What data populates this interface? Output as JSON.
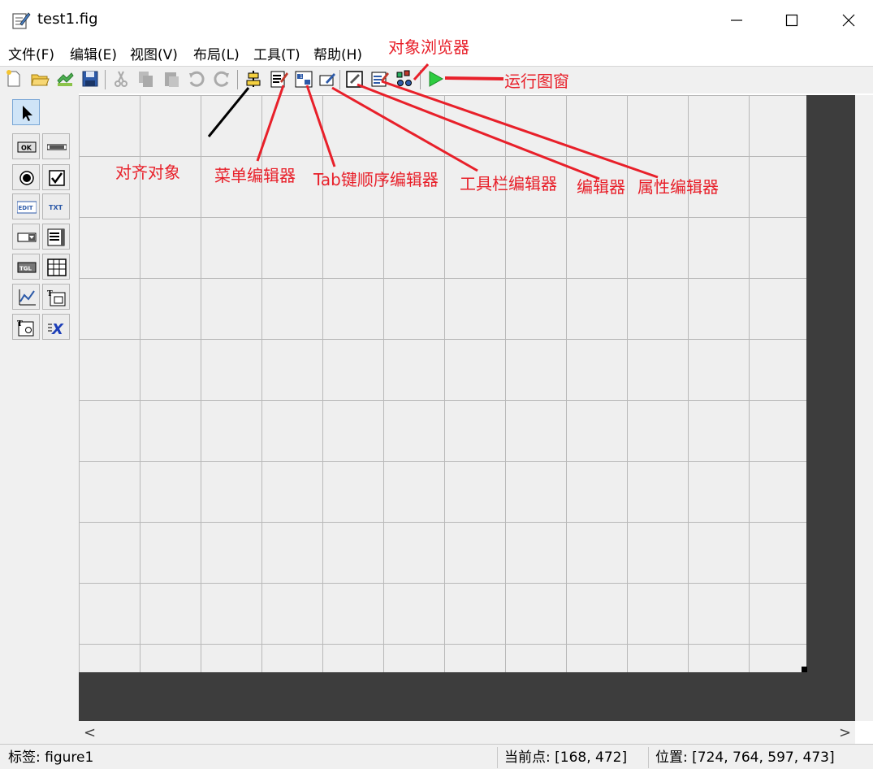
{
  "window": {
    "title": "test1.fig",
    "icon": "figure-file-icon",
    "controls": {
      "minimize": "minimize-icon",
      "maximize": "maximize-icon",
      "close": "close-icon"
    }
  },
  "menubar": {
    "items": [
      "文件(F)",
      "编辑(E)",
      "视图(V)",
      "布局(L)",
      "工具(T)",
      "帮助(H)"
    ]
  },
  "toolbar": {
    "icons": [
      "new-file-icon",
      "open-folder-icon",
      "save-as-icon",
      "save-icon",
      "cut-icon",
      "copy-icon",
      "paste-icon",
      "undo-icon",
      "redo-icon",
      "align-objects-icon",
      "menu-editor-icon",
      "tab-order-editor-icon",
      "toolbar-editor-icon",
      "editor-icon",
      "property-inspector-icon",
      "object-browser-icon",
      "run-figure-icon"
    ]
  },
  "palette": {
    "items": [
      {
        "name": "select-arrow-icon",
        "text": ""
      },
      {
        "name": "push-button-icon",
        "text": "OK"
      },
      {
        "name": "slider-icon",
        "text": ""
      },
      {
        "name": "radio-button-icon",
        "text": ""
      },
      {
        "name": "checkbox-icon",
        "text": ""
      },
      {
        "name": "edit-text-icon",
        "text": "EDIT"
      },
      {
        "name": "static-text-icon",
        "text": "TXT"
      },
      {
        "name": "popup-menu-icon",
        "text": ""
      },
      {
        "name": "listbox-icon",
        "text": ""
      },
      {
        "name": "toggle-button-icon",
        "text": "TGL"
      },
      {
        "name": "table-icon",
        "text": ""
      },
      {
        "name": "axes-icon",
        "text": ""
      },
      {
        "name": "panel-icon",
        "text": "T"
      },
      {
        "name": "button-group-icon",
        "text": "T"
      },
      {
        "name": "activex-icon",
        "text": "X"
      }
    ]
  },
  "annotations": {
    "object_browser": "对象浏览器",
    "run_figure": "运行图窗",
    "align_objects": "对齐对象",
    "menu_editor": "菜单编辑器",
    "tab_order_editor": "Tab键顺序编辑器",
    "toolbar_editor": "工具栏编辑器",
    "editor": "编辑器",
    "property_inspector": "属性编辑器",
    "color": "#e8202a"
  },
  "statusbar": {
    "tag": "标签: figure1",
    "current_point": "当前点:  [168, 472]",
    "position": "位置: [724, 764, 597, 473]"
  },
  "scroll": {
    "left": "<",
    "right": ">"
  }
}
